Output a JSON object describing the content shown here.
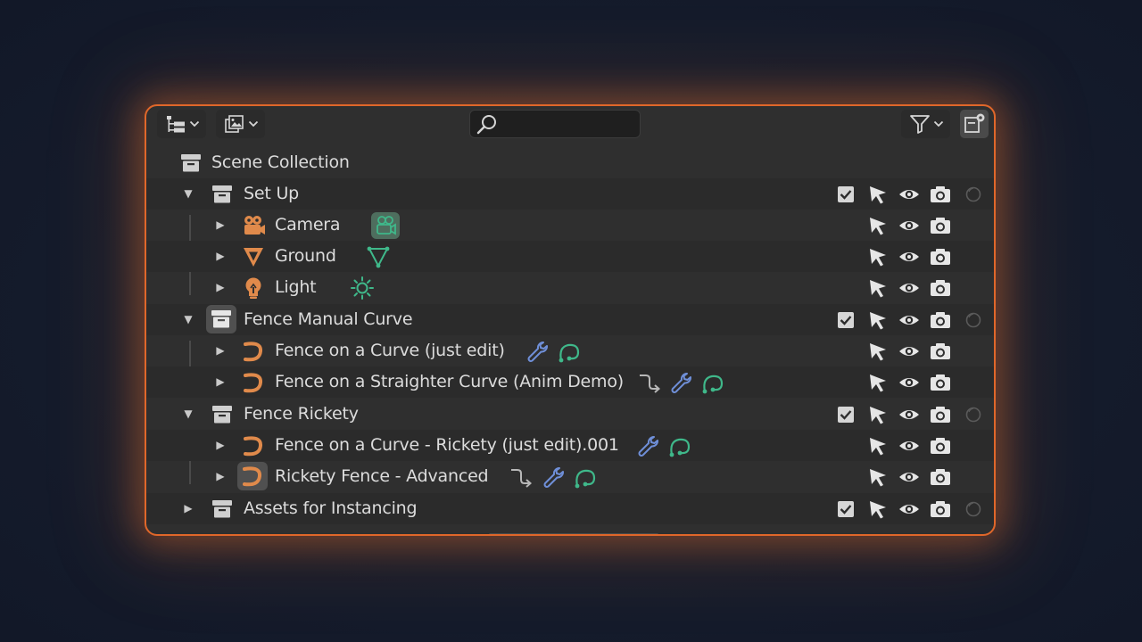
{
  "header": {
    "display_mode_icon": "outliner-tree-icon",
    "view_layer_icon": "image-stack-icon",
    "search": {
      "placeholder": "",
      "value": ""
    },
    "filter_icon": "filter-funnel-icon",
    "new_collection_icon": "new-collection-icon"
  },
  "colors": {
    "accent_border": "#e0672a",
    "panel_bg": "#2f2f2f",
    "object_orange": "#e08a4b",
    "data_green": "#3fb88a",
    "modifier_blue": "#6f8fd8"
  },
  "tree": {
    "scene_collection": {
      "label": "Scene Collection",
      "icon": "collection-box-icon"
    },
    "rows": [
      {
        "label": "Set Up",
        "icon": "collection-box-icon",
        "expanded": true,
        "checkbox": true
      },
      {
        "label": "Camera",
        "icon": "camera-object-icon",
        "badges": [
          "camera-data-icon"
        ]
      },
      {
        "label": "Ground",
        "icon": "mesh-object-icon",
        "badges": [
          "mesh-data-icon"
        ]
      },
      {
        "label": "Light",
        "icon": "light-object-icon",
        "badges": [
          "sun-data-icon"
        ]
      },
      {
        "label": "Fence Manual Curve",
        "icon": "collection-box-icon",
        "expanded": true,
        "checkbox": true,
        "active": true
      },
      {
        "label": "Fence on a Curve (just edit)",
        "icon": "curve-object-icon",
        "badges": [
          "wrench-icon",
          "curve-data-icon"
        ]
      },
      {
        "label": "Fence on a Straighter Curve (Anim Demo)",
        "icon": "curve-object-icon",
        "badges": [
          "animation-path-icon",
          "wrench-icon",
          "curve-data-icon"
        ]
      },
      {
        "label": "Fence Rickety",
        "icon": "collection-box-icon",
        "expanded": true,
        "checkbox": true
      },
      {
        "label": "Fence on a Curve - Rickety (just edit).001",
        "icon": "curve-object-icon",
        "badges": [
          "wrench-icon",
          "curve-data-icon"
        ]
      },
      {
        "label": "Rickety Fence - Advanced",
        "icon": "curve-object-icon",
        "badges": [
          "animation-path-icon",
          "wrench-icon",
          "curve-data-icon"
        ],
        "active": true
      },
      {
        "label": "Assets for Instancing",
        "icon": "collection-box-icon",
        "expanded": false,
        "checkbox": true
      }
    ]
  },
  "restriction_toggles": [
    "select-arrow-icon",
    "eye-icon",
    "camera-render-icon",
    "holdout-circle-icon"
  ]
}
